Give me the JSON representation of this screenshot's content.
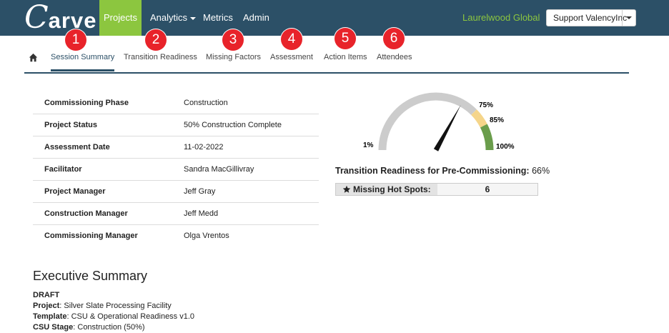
{
  "navbar": {
    "logo_first": "C",
    "logo_rest": "arve",
    "items": [
      {
        "label": "Projects",
        "active": true
      },
      {
        "label": "Analytics",
        "dropdown": true
      },
      {
        "label": "Metrics"
      },
      {
        "label": "Admin"
      }
    ],
    "org_name": "Laurelwood Global",
    "user_label": "Support ValencyInc"
  },
  "tabs": [
    {
      "label": "Session Summary",
      "number": "1",
      "active": true
    },
    {
      "label": "Transition Readiness",
      "number": "2"
    },
    {
      "label": "Missing Factors",
      "number": "3"
    },
    {
      "label": "Assessment",
      "number": "4"
    },
    {
      "label": "Action Items",
      "number": "5"
    },
    {
      "label": "Attendees",
      "number": "6"
    }
  ],
  "details": [
    {
      "label": "Commissioning Phase",
      "value": "Construction"
    },
    {
      "label": "Project Status",
      "value": "50% Construction Complete"
    },
    {
      "label": "Assessment Date",
      "value": "11-02-2022"
    },
    {
      "label": "Facilitator",
      "value": "Sandra MacGillivray"
    },
    {
      "label": "Project Manager",
      "value": "Jeff Gray"
    },
    {
      "label": "Construction Manager",
      "value": "Jeff Medd"
    },
    {
      "label": "Commissioning Manager",
      "value": "Olga Vrentos"
    }
  ],
  "gauge": {
    "labels": {
      "min": "1%",
      "l75": "75%",
      "l85": "85%",
      "max": "100%"
    },
    "value_percent": 66,
    "colors": {
      "base": "#cccccc",
      "yellow": "#f5d58a",
      "green": "#6a9d4b",
      "needle": "#111111"
    }
  },
  "readiness": {
    "label": "Transition Readiness for Pre-Commissioning:",
    "value": "66%"
  },
  "hotspots": {
    "label": "Missing Hot Spots:",
    "value": "6"
  },
  "executive_summary": {
    "title": "Executive Summary",
    "status": "DRAFT",
    "lines": [
      {
        "key": "Project",
        "value": "Silver Slate Processing Facility"
      },
      {
        "key": "Template",
        "value": "CSU & Operational Readiness v1.0"
      },
      {
        "key": "CSU Stage",
        "value": "Construction (50%)"
      }
    ]
  },
  "colors": {
    "navbar": "#2c5067",
    "accent": "#8cc63f",
    "badge": "#e8232a"
  }
}
